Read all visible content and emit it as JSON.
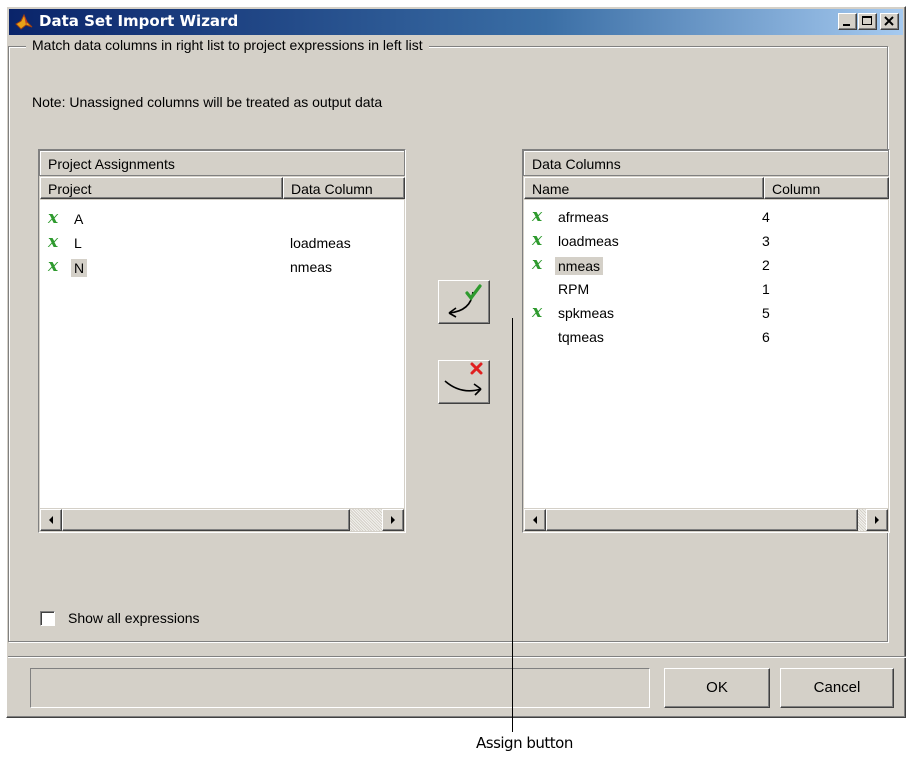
{
  "window": {
    "title": "Data Set Import Wizard",
    "controls": [
      "minimize-icon",
      "maximize-icon",
      "close-icon"
    ]
  },
  "group_label": "Match data columns in right list to project expressions in left list",
  "note": "Note: Unassigned columns will be treated as output data",
  "left_panel": {
    "title": "Project Assignments",
    "columns": [
      "Project",
      "Data Column"
    ],
    "rows": [
      {
        "mark": "x",
        "project": "A",
        "data_column": ""
      },
      {
        "mark": "x",
        "project": "L",
        "data_column": "loadmeas"
      },
      {
        "mark": "x",
        "project": "N",
        "data_column": "nmeas",
        "selected": true
      }
    ]
  },
  "right_panel": {
    "title": "Data Columns",
    "columns": [
      "Name",
      "Column"
    ],
    "rows": [
      {
        "mark": "x",
        "name": "afrmeas",
        "column": "4"
      },
      {
        "mark": "x",
        "name": "loadmeas",
        "column": "3"
      },
      {
        "mark": "x",
        "name": "nmeas",
        "column": "2",
        "selected": true
      },
      {
        "mark": "",
        "name": "RPM",
        "column": "1"
      },
      {
        "mark": "x",
        "name": "spkmeas",
        "column": "5"
      },
      {
        "mark": "",
        "name": "tqmeas",
        "column": "6"
      }
    ]
  },
  "assign_button_icon": "assign-arrow-check-icon",
  "unassign_button_icon": "unassign-arrow-x-icon",
  "checkbox": {
    "label": "Show all expressions",
    "checked": false
  },
  "buttons": {
    "ok": "OK",
    "cancel": "Cancel"
  },
  "callout": "Assign button",
  "colors": {
    "titlebar": "#0a246a",
    "face": "#d4d0c8",
    "check": "#2e9a2e",
    "x_red": "#e02020"
  }
}
